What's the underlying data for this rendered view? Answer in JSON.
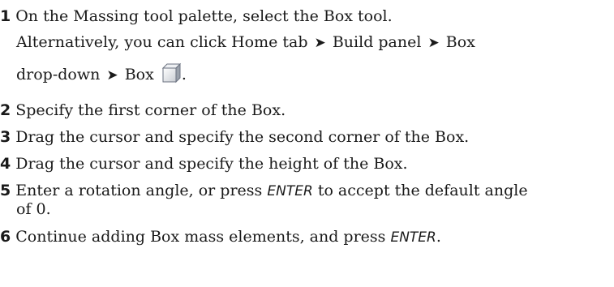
{
  "steps": [
    {
      "number": "1",
      "text": "On the Massing tool palette, select the Box tool.",
      "alt_prefix": "Alternatively, you can click Home tab",
      "alt_build": "Build panel",
      "alt_box": "Box",
      "alt_dropdown": "drop-down",
      "alt_box_end": "Box",
      "alt_end": ".",
      "arrow_glyph": "➤",
      "icon": "box-tool-icon"
    },
    {
      "number": "2",
      "text": "Specify the first corner of the Box."
    },
    {
      "number": "3",
      "text": "Drag the cursor and specify the second corner of the Box."
    },
    {
      "number": "4",
      "text": "Drag the cursor and specify the height of the Box."
    },
    {
      "number": "5",
      "text_before": "Enter a rotation angle, or press",
      "key": "ENTER",
      "text_after": "to accept the default angle",
      "text_line2": "of 0."
    },
    {
      "number": "6",
      "text_before": "Continue adding Box mass elements, and press",
      "key": "ENTER",
      "text_after": "."
    }
  ]
}
